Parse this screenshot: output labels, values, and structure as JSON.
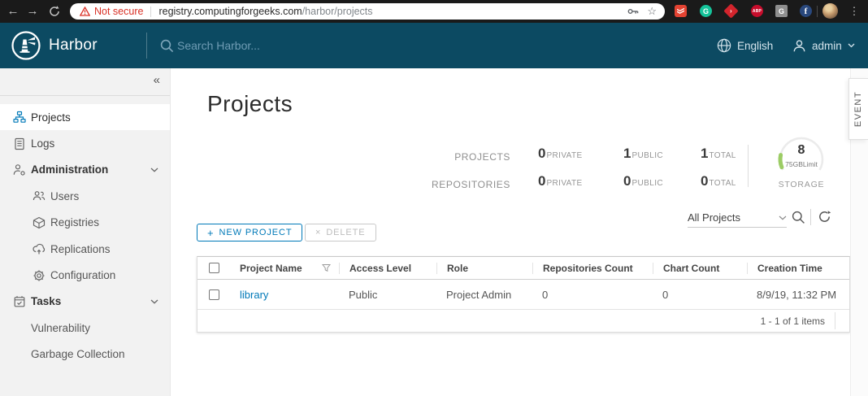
{
  "colors": {
    "accent": "#0079b8",
    "header_bg": "#0c4a62",
    "not_secure_red": "#d93025",
    "storage_gauge_green": "#9ccc65"
  },
  "browser": {
    "back_icon": "←",
    "forward_icon": "→",
    "security_warning": "Not secure",
    "url_host": "registry.computingforgeeks.com",
    "url_path": "/harbor/projects",
    "bookmark_star_icon": "☆",
    "menu_icon": "⋮",
    "extensions": [
      {
        "name": "todoist",
        "label": ""
      },
      {
        "name": "grammarly",
        "label": "G"
      },
      {
        "name": "adguard",
        "label": "›"
      },
      {
        "name": "adblock-plus",
        "label": "ABP"
      },
      {
        "name": "g-extension",
        "label": "G"
      },
      {
        "name": "facebook",
        "label": "f"
      }
    ]
  },
  "header": {
    "brand": "Harbor",
    "search_placeholder": "Search Harbor...",
    "language": "English",
    "user": "admin"
  },
  "sidebar": {
    "collapse_icon": "«",
    "items": [
      {
        "label": "Projects"
      },
      {
        "label": "Logs"
      },
      {
        "label": "Administration"
      },
      {
        "label": "Users"
      },
      {
        "label": "Registries"
      },
      {
        "label": "Replications"
      },
      {
        "label": "Configuration"
      },
      {
        "label": "Tasks"
      },
      {
        "label": "Vulnerability"
      },
      {
        "label": "Garbage Collection"
      }
    ]
  },
  "main": {
    "title": "Projects",
    "stats": {
      "projects_label": "PROJECTS",
      "repositories_label": "REPOSITORIES",
      "private_label": "PRIVATE",
      "public_label": "PUBLIC",
      "total_label": "TOTAL",
      "projects": {
        "private": "0",
        "public": "1",
        "total": "1"
      },
      "repositories": {
        "private": "0",
        "public": "0",
        "total": "0"
      },
      "storage": {
        "used": "8",
        "limit": "75GBLimit",
        "label": "STORAGE"
      }
    },
    "toolbar": {
      "plus_icon": "+",
      "new_project_label": "NEW PROJECT",
      "delete_icon": "×",
      "delete_label": "DELETE",
      "filter_value": "All Projects"
    },
    "table": {
      "columns": [
        "Project Name",
        "Access Level",
        "Role",
        "Repositories Count",
        "Chart Count",
        "Creation Time"
      ],
      "rows": [
        {
          "project_name": "library",
          "access_level": "Public",
          "role": "Project Admin",
          "repositories_count": "0",
          "chart_count": "0",
          "creation_time": "8/9/19, 11:32 PM"
        }
      ],
      "pagination": "1 - 1 of 1 items"
    },
    "event_tab_label": "EVENT"
  }
}
